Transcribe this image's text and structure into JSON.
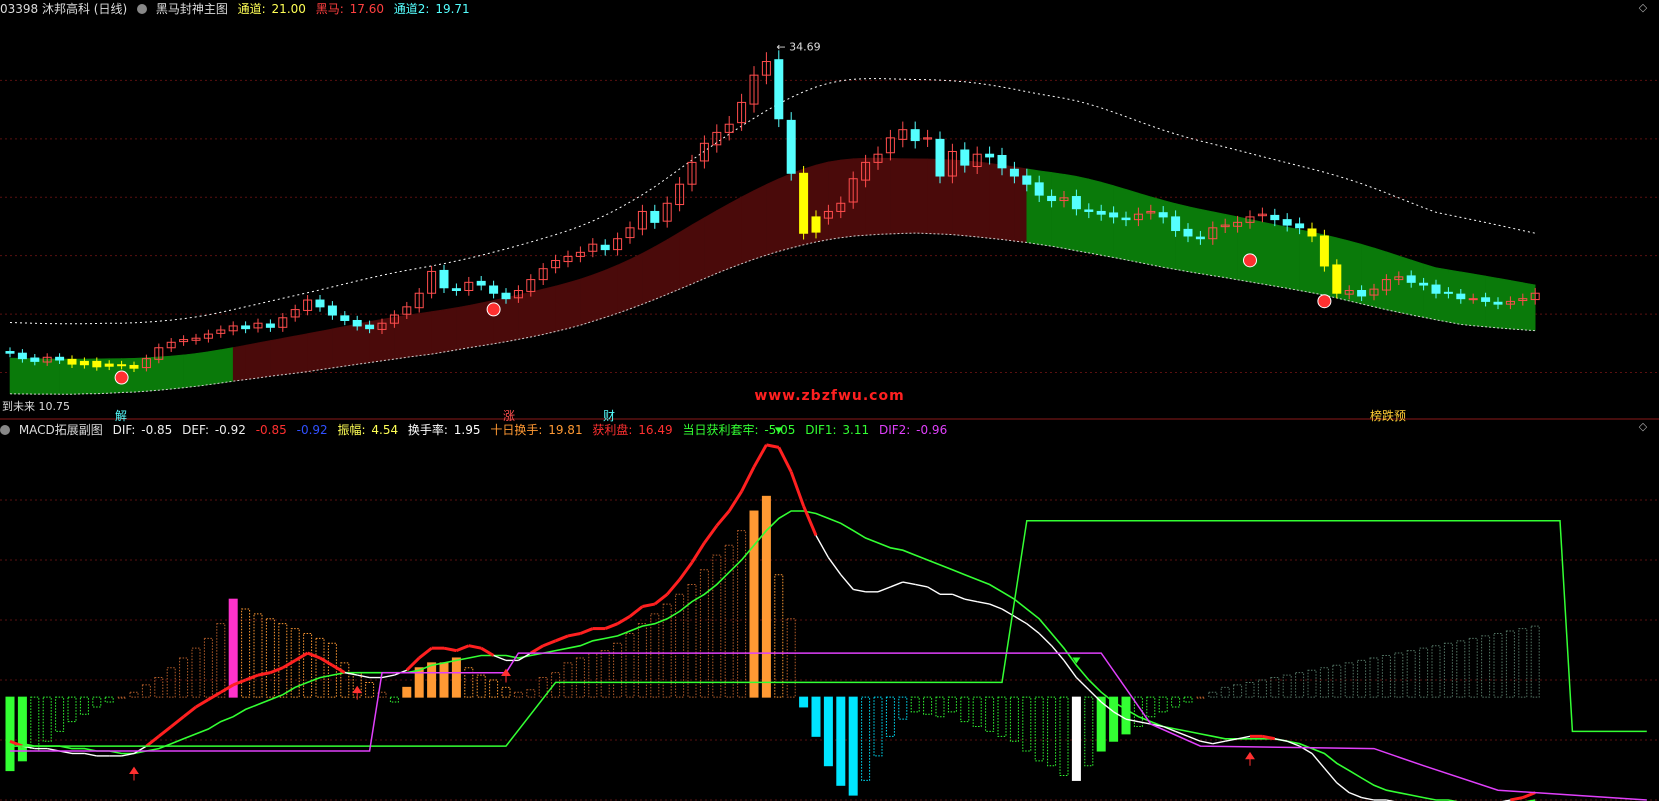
{
  "header": {
    "code_name": "03398 沐邦高科 (日线)",
    "indicator": "黑马封神主图",
    "ch1_label": "通道:",
    "ch1_value": "21.00",
    "horse_label": "黑马:",
    "horse_value": "17.60",
    "ch2_label": "通道2:",
    "ch2_value": "19.71"
  },
  "sub_header": {
    "indicator": "MACD拓展副图",
    "dif_label": "DIF:",
    "dif_value": "-0.85",
    "def_label": "DEF:",
    "def_value": "-0.92",
    "v1": "-0.85",
    "v2": "-0.92",
    "amp_label": "振幅:",
    "amp_value": "4.54",
    "turn_label": "换手率:",
    "turn_value": "1.95",
    "turn10_label": "十日换手:",
    "turn10_value": "19.81",
    "profit_label": "获利盘:",
    "profit_value": "16.49",
    "day_label": "当日获利套牢:",
    "day_value": "-5.05",
    "dif1_label": "DIF1:",
    "dif1_value": "3.11",
    "dif2_label": "DIF2:",
    "dif2_value": "-0.96"
  },
  "markers": {
    "jie": "解",
    "zhang": "涨",
    "cai": "财",
    "bang": "榜跌预",
    "low_label": "到未来",
    "low_value": "10.75"
  },
  "watermark": "www.zbzfwu.com",
  "colors": {
    "up": "#ff4d4d",
    "down": "#55ffff",
    "yellow": "#ffff00",
    "green_band": "#0a7a0a",
    "red_band": "#4a0a0a",
    "macd_orange": "#ff9933",
    "macd_cyan": "#00e5ff",
    "macd_green": "#33ff33",
    "magenta": "#e040fb",
    "white": "#ffffff"
  },
  "chart_data": {
    "type": "candlestick",
    "max_label": "34.69",
    "ylim": [
      9.5,
      36.5
    ],
    "close": [
      12.2,
      11.8,
      11.6,
      11.9,
      11.7,
      11.4,
      11.6,
      11.2,
      11.4,
      11.3,
      11.1,
      11.8,
      12.6,
      13.0,
      13.2,
      13.3,
      13.6,
      13.9,
      14.2,
      14.0,
      14.4,
      14.1,
      14.8,
      15.4,
      16.1,
      15.6,
      15.0,
      14.6,
      14.2,
      14.0,
      14.4,
      15.0,
      15.6,
      16.6,
      18.2,
      17.0,
      16.8,
      17.4,
      17.2,
      16.6,
      16.2,
      16.8,
      17.6,
      18.4,
      19.0,
      19.3,
      19.6,
      20.2,
      19.8,
      20.6,
      21.4,
      22.6,
      21.8,
      23.2,
      24.6,
      26.2,
      27.6,
      28.4,
      29.0,
      30.6,
      32.6,
      33.6,
      29.4,
      25.4,
      21.0,
      22.2,
      22.6,
      23.2,
      25.0,
      26.2,
      26.8,
      28.0,
      28.6,
      27.8,
      28.0,
      25.2,
      27.0,
      26.0,
      26.8,
      26.6,
      25.8,
      25.2,
      24.6,
      23.8,
      23.4,
      23.6,
      22.8,
      22.6,
      22.4,
      22.2,
      22.0,
      22.4,
      22.6,
      22.2,
      21.2,
      20.8,
      20.6,
      21.4,
      21.6,
      21.8,
      22.2,
      22.4,
      22.0,
      21.6,
      21.4,
      20.8,
      18.6,
      16.6,
      16.8,
      16.4,
      16.9,
      17.6,
      17.8,
      17.4,
      17.2,
      16.6,
      16.6,
      16.2,
      16.2,
      16.0,
      15.8,
      16.0,
      16.2,
      16.6
    ],
    "series": [
      {
        "name": "通道",
        "values": []
      },
      {
        "name": "黑马",
        "values": []
      },
      {
        "name": "通道2",
        "values": []
      }
    ],
    "macd": {
      "ylim": [
        -4.2,
        10.5
      ],
      "dif": [
        -1.8,
        -2.0,
        -2.1,
        -2.1,
        -2.2,
        -2.3,
        -2.3,
        -2.4,
        -2.4,
        -2.4,
        -2.3,
        -2.0,
        -1.6,
        -1.2,
        -0.8,
        -0.4,
        -0.1,
        0.2,
        0.5,
        0.7,
        0.9,
        1.0,
        1.2,
        1.5,
        1.8,
        1.6,
        1.3,
        1.0,
        0.9,
        0.8,
        0.8,
        0.9,
        1.1,
        1.6,
        2.0,
        2.0,
        1.9,
        2.1,
        2.0,
        1.7,
        1.5,
        1.5,
        1.8,
        2.1,
        2.3,
        2.5,
        2.6,
        2.8,
        2.8,
        3.0,
        3.3,
        3.7,
        3.8,
        4.2,
        4.8,
        5.5,
        6.3,
        7.0,
        7.6,
        8.4,
        9.4,
        10.3,
        10.2,
        9.2,
        7.8,
        6.6,
        5.7,
        5.0,
        4.4,
        4.3,
        4.3,
        4.5,
        4.7,
        4.6,
        4.5,
        4.2,
        4.2,
        4.0,
        3.9,
        3.8,
        3.6,
        3.3,
        3.0,
        2.6,
        2.1,
        1.5,
        0.8,
        0.3,
        -0.2,
        -0.6,
        -0.9,
        -1.0,
        -1.1,
        -1.2,
        -1.4,
        -1.6,
        -1.8,
        -1.9,
        -1.8,
        -1.7,
        -1.6,
        -1.6,
        -1.7,
        -1.8,
        -2.0,
        -2.3,
        -2.9,
        -3.5,
        -3.9,
        -4.1,
        -4.2,
        -4.2,
        -4.3,
        -4.3,
        -4.3,
        -4.3,
        -4.3,
        -4.4,
        -4.4,
        -4.4,
        -4.3,
        -4.2,
        -4.1,
        -3.9
      ],
      "dea": [
        -1.9,
        -1.9,
        -2.0,
        -2.0,
        -2.0,
        -2.1,
        -2.1,
        -2.2,
        -2.2,
        -2.3,
        -2.3,
        -2.2,
        -2.1,
        -1.9,
        -1.7,
        -1.5,
        -1.3,
        -1.0,
        -0.8,
        -0.5,
        -0.3,
        -0.1,
        0.1,
        0.4,
        0.6,
        0.8,
        0.9,
        1.0,
        1.0,
        1.0,
        1.0,
        1.0,
        1.0,
        1.1,
        1.3,
        1.4,
        1.5,
        1.6,
        1.7,
        1.7,
        1.7,
        1.6,
        1.7,
        1.8,
        1.9,
        2.0,
        2.1,
        2.3,
        2.4,
        2.5,
        2.7,
        2.9,
        3.0,
        3.2,
        3.5,
        3.9,
        4.2,
        4.6,
        5.1,
        5.6,
        6.2,
        6.8,
        7.3,
        7.6,
        7.6,
        7.5,
        7.3,
        7.1,
        6.8,
        6.5,
        6.3,
        6.1,
        6.0,
        5.8,
        5.6,
        5.4,
        5.2,
        5.0,
        4.8,
        4.6,
        4.3,
        4.0,
        3.6,
        3.2,
        2.6,
        2.0,
        1.3,
        0.7,
        0.2,
        -0.2,
        -0.5,
        -0.8,
        -1.0,
        -1.2,
        -1.3,
        -1.4,
        -1.5,
        -1.6,
        -1.7,
        -1.7,
        -1.7,
        -1.7,
        -1.7,
        -1.8,
        -1.9,
        -2.1,
        -2.3,
        -2.7,
        -3.0,
        -3.3,
        -3.6,
        -3.8,
        -3.9,
        -4.0,
        -4.1,
        -4.2,
        -4.2,
        -4.3,
        -4.3,
        -4.3,
        -4.3,
        -4.3,
        -4.3,
        -4.2
      ],
      "hist": [
        -3.0,
        -2.6,
        -2.2,
        -1.8,
        -1.4,
        -1.0,
        -0.7,
        -0.4,
        -0.2,
        0.0,
        0.2,
        0.5,
        0.8,
        1.2,
        1.6,
        2.0,
        2.4,
        3.0,
        4.0,
        3.6,
        3.4,
        3.2,
        3.0,
        2.8,
        2.6,
        2.4,
        2.2,
        1.4,
        1.0,
        0.6,
        0.2,
        -0.2,
        0.4,
        1.2,
        1.4,
        1.4,
        1.6,
        1.2,
        0.9,
        0.7,
        0.4,
        0.2,
        0.3,
        0.8,
        1.0,
        1.4,
        1.6,
        1.8,
        1.9,
        2.2,
        2.6,
        3.0,
        3.4,
        3.8,
        4.2,
        4.6,
        5.2,
        5.8,
        6.2,
        6.8,
        7.6,
        8.2,
        5.0,
        3.2,
        -0.4,
        -1.6,
        -2.8,
        -3.6,
        -4.0,
        -3.4,
        -2.4,
        -1.6,
        -0.9,
        -0.6,
        -0.7,
        -0.8,
        -0.6,
        -1.0,
        -1.2,
        -1.4,
        -1.6,
        -1.8,
        -2.2,
        -2.6,
        -2.8,
        -3.2,
        -3.4,
        -2.8,
        -2.2,
        -1.8,
        -1.5,
        -1.2,
        -0.8,
        -0.6,
        -0.4,
        -0.2,
        0.0,
        0.2,
        0.4,
        0.5,
        0.6,
        0.7,
        0.8,
        0.9,
        1.0,
        1.1,
        1.2,
        1.3,
        1.4,
        1.5,
        1.6,
        1.7,
        1.8,
        1.9,
        2.0,
        2.1,
        2.2,
        2.3,
        2.4,
        2.5,
        2.6,
        2.7,
        2.8,
        2.9
      ],
      "dif1_steps": [
        [
          0,
          -2.0
        ],
        [
          40,
          -2.0
        ],
        [
          44,
          0.6
        ],
        [
          80,
          0.6
        ],
        [
          82,
          7.2
        ],
        [
          125,
          7.2
        ],
        [
          126,
          -1.4
        ],
        [
          132,
          -1.4
        ]
      ],
      "dif2_steps": [
        [
          0,
          -2.2
        ],
        [
          10,
          -2.2
        ],
        [
          29,
          -2.2
        ],
        [
          30,
          1.0
        ],
        [
          40,
          1.0
        ],
        [
          41,
          1.8
        ],
        [
          88,
          1.8
        ],
        [
          92,
          -1.1
        ],
        [
          96,
          -2.0
        ],
        [
          110,
          -2.1
        ],
        [
          114,
          -2.8
        ],
        [
          120,
          -3.8
        ],
        [
          132,
          -4.2
        ]
      ]
    }
  }
}
